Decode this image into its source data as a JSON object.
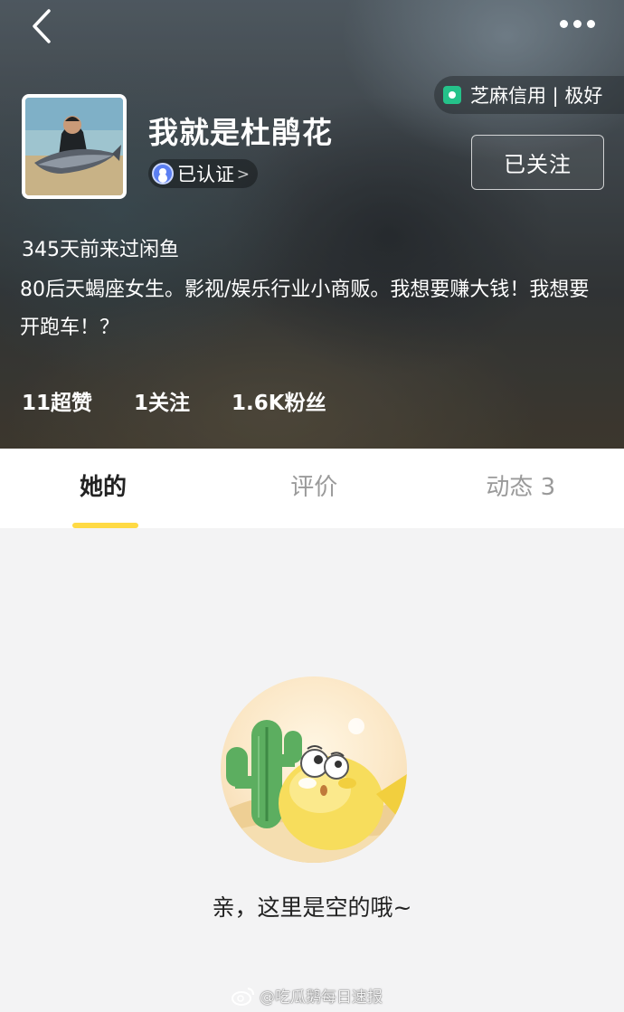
{
  "header": {
    "credit_badge": "芝麻信用 | 极好",
    "username": "我就是杜鹃花",
    "verified_label": "已认证",
    "follow_button": "已关注",
    "last_seen": "345天前来过闲鱼",
    "bio": "80后天蝎座女生。影视/娱乐行业小商贩。我想要赚大钱！我想要开跑车！？",
    "stats": {
      "likes": "11超赞",
      "following": "1关注",
      "followers": "1.6K粉丝"
    }
  },
  "tabs": [
    {
      "label": "她的",
      "active": true
    },
    {
      "label": "评价",
      "active": false
    },
    {
      "label": "动态 3",
      "active": false
    }
  ],
  "empty_state": {
    "message": "亲，这里是空的哦~"
  },
  "watermark": "@吃瓜鹅每日速报",
  "colors": {
    "accent": "#ffda44",
    "credit_green": "#25c28a",
    "verified_blue": "#5b7ff2"
  },
  "icons": [
    "back-icon",
    "more-icon",
    "sesame-credit-icon",
    "verified-icon",
    "chevron-right-icon",
    "weibo-icon"
  ]
}
